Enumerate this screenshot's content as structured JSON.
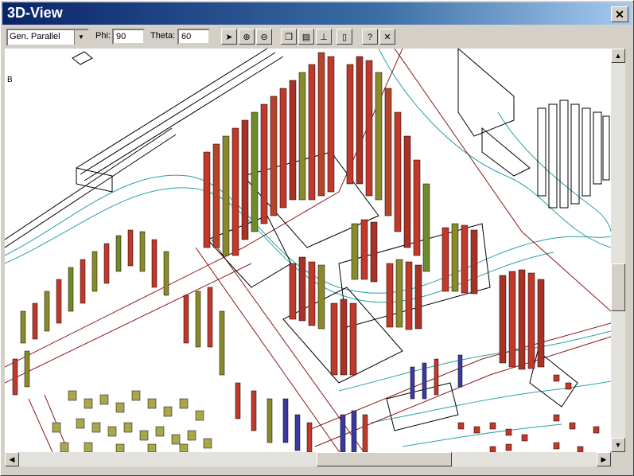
{
  "window": {
    "title": "3D-View",
    "close_icon": "close-icon"
  },
  "toolbar": {
    "projection": "Gen. Parallel",
    "phi_label": "Phi:",
    "phi_value": "90",
    "theta_label": "Theta:",
    "theta_value": "60",
    "buttons": [
      "pointer-icon",
      "zoom-in-icon",
      "zoom-out-icon",
      "copy-icon",
      "print-icon",
      "export-icon",
      "settings-icon",
      "help-icon",
      "close-icon"
    ]
  },
  "view": {
    "corner_label": "B"
  },
  "colors": {
    "title_start": "#0a246a",
    "title_end": "#a6caf0",
    "red": "#c0392b",
    "olive": "#8a8a2a",
    "blue": "#3a3aa0",
    "cyan": "#2aa0a8",
    "street": "#8b1a1a"
  }
}
